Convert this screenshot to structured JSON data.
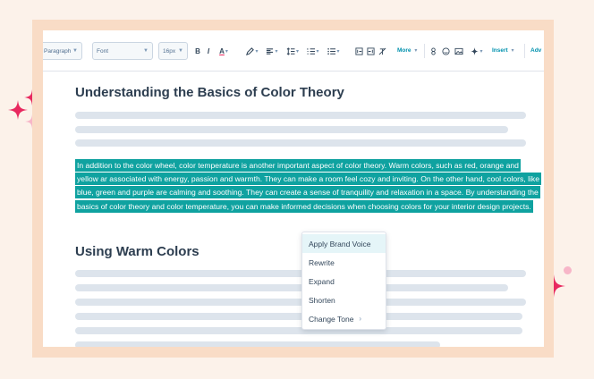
{
  "toolbar": {
    "paragraph_select": "Paragraph",
    "font_select": "Font",
    "size_select": "16px",
    "bold": "B",
    "italic": "I",
    "text_color": "A",
    "more_label": "More",
    "insert_label": "Insert",
    "advanced_label": "Adv"
  },
  "document": {
    "heading1": "Understanding the Basics of Color Theory",
    "selected_paragraph": "In addition to the color wheel, color temperature is another important aspect of color theory. Warm colors, such as red, orange and yellow ar associated with energy, passion and warmth. They can make a room feel cozy and inviting. On the other hand, cool colors, like blue, green and purple are calming and soothing. They can create a sense of tranquility and relaxation in a space. By understanding the basics of color theory and color temperature, you can make informed decisions when choosing colors for your interior design projects.",
    "heading2": "Using Warm Colors"
  },
  "ai_menu": {
    "items": [
      {
        "label": "Apply Brand Voice"
      },
      {
        "label": "Rewrite"
      },
      {
        "label": "Expand"
      },
      {
        "label": "Shorten"
      },
      {
        "label": "Change Tone"
      }
    ],
    "submenu_chevron": "›"
  },
  "colors": {
    "selection": "#0fa2a0",
    "sparkle": "#e8295f",
    "sparkle_light": "#f7b6c8",
    "frame": "#f9dcc6",
    "background": "#fcf2ea"
  }
}
